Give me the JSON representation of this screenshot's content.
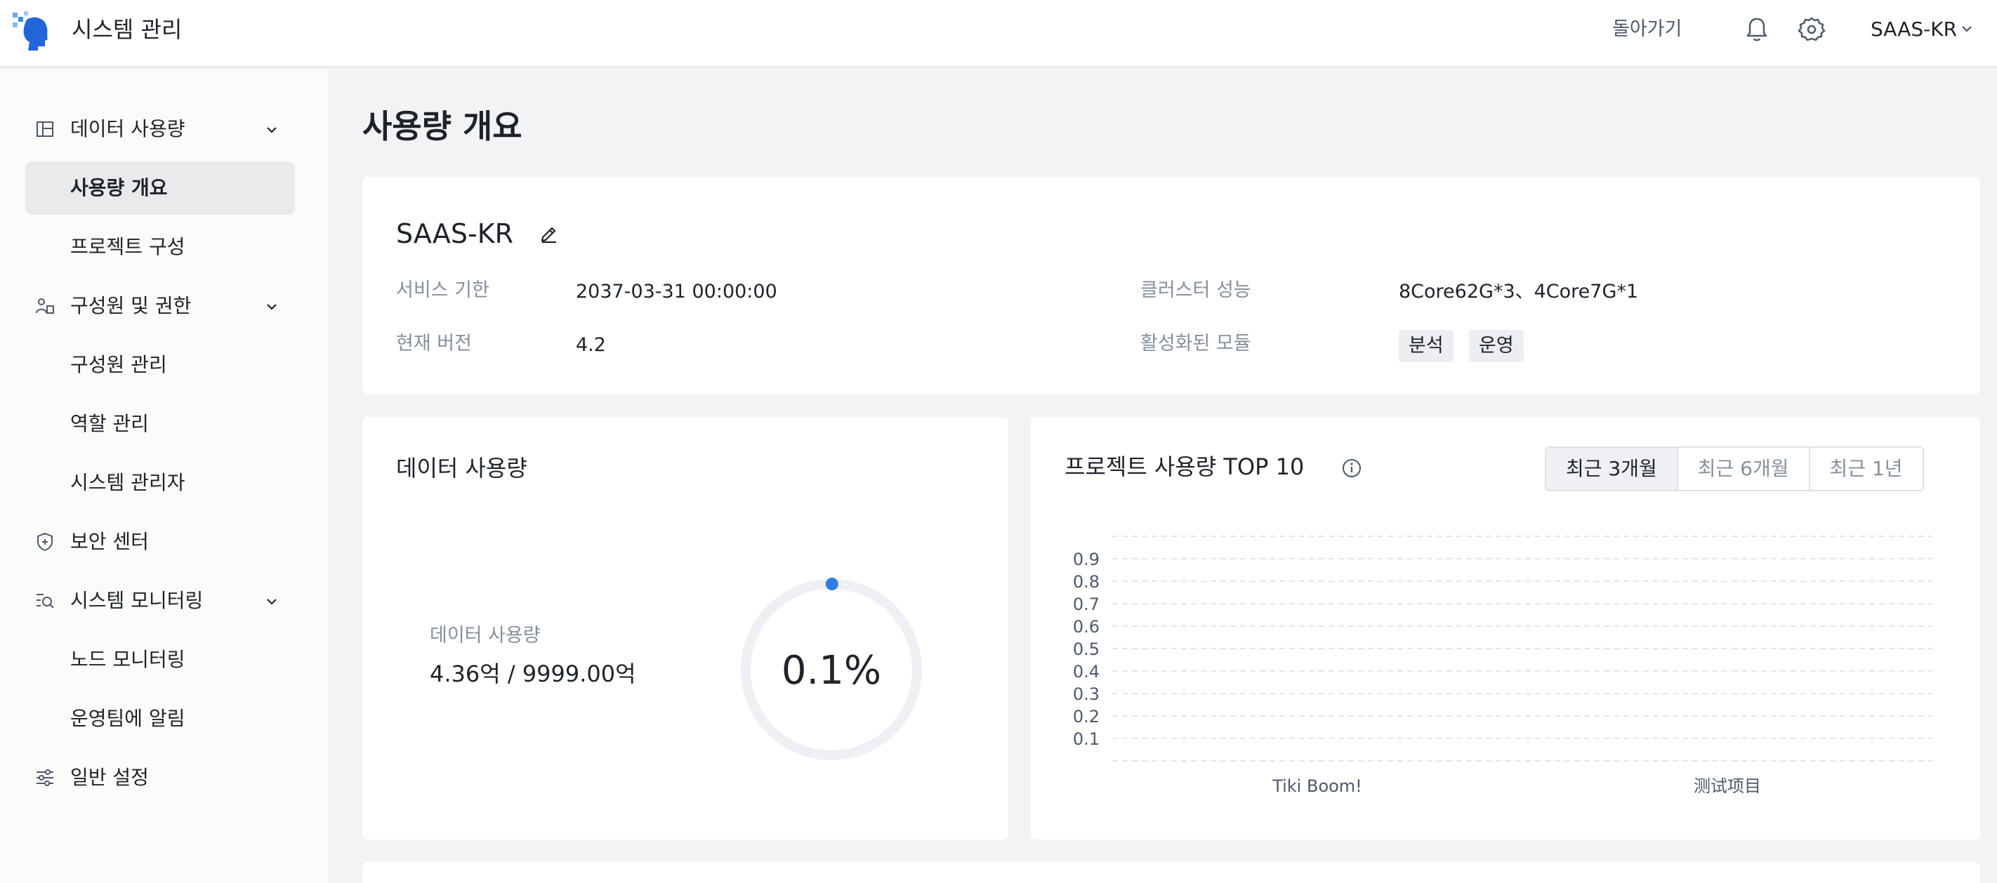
{
  "header": {
    "app_title": "시스템 관리",
    "back_label": "돌아가기",
    "tenant": "SAAS-KR"
  },
  "sidebar": {
    "items": [
      {
        "label": "데이터 사용량",
        "type": "group",
        "icon": "dashboard-icon"
      },
      {
        "label": "사용량 개요",
        "type": "sub",
        "active": true
      },
      {
        "label": "프로젝트 구성",
        "type": "sub"
      },
      {
        "label": "구성원 및 권한",
        "type": "group",
        "icon": "users-icon"
      },
      {
        "label": "구성원 관리",
        "type": "sub"
      },
      {
        "label": "역할 관리",
        "type": "sub"
      },
      {
        "label": "시스템 관리자",
        "type": "sub"
      },
      {
        "label": "보안 센터",
        "type": "item",
        "icon": "shield-icon"
      },
      {
        "label": "시스템 모니터링",
        "type": "group",
        "icon": "monitor-search-icon"
      },
      {
        "label": "노드 모니터링",
        "type": "sub"
      },
      {
        "label": "운영팀에 알림",
        "type": "sub"
      },
      {
        "label": "일반 설정",
        "type": "item",
        "icon": "sliders-icon"
      }
    ]
  },
  "page": {
    "title": "사용량 개요"
  },
  "info": {
    "tenant_name": "SAAS-KR",
    "service_period_label": "서비스 기한",
    "service_period_value": "2037-03-31 00:00:00",
    "version_label": "현재 버전",
    "version_value": "4.2",
    "cluster_label": "클러스터 성능",
    "cluster_value": "8Core62G*3、4Core7G*1",
    "modules_label": "활성화된 모듈",
    "modules": [
      "분석",
      "운영"
    ]
  },
  "usage": {
    "title": "데이터 사용량",
    "label": "데이터 사용량",
    "value": "4.36억 / 9999.00억",
    "percent_text": "0.1%",
    "percent": 0.1
  },
  "top_projects": {
    "title": "프로젝트 사용량 TOP 10",
    "ranges": [
      "최근 3개월",
      "최근 6개월",
      "최근 1년"
    ],
    "active_range": "최근 3개월"
  },
  "chart_data": {
    "type": "bar",
    "categories": [
      "Tiki Boom!",
      "测试项目"
    ],
    "values": [
      0,
      0
    ],
    "yticks": [
      "0.1",
      "0.2",
      "0.3",
      "0.4",
      "0.5",
      "0.6",
      "0.7",
      "0.8",
      "0.9"
    ],
    "ylim": [
      0,
      1
    ],
    "grid": true,
    "title": "",
    "xlabel": "",
    "ylabel": ""
  },
  "colors": {
    "accent": "#2f7be6",
    "gauge_track": "#eef0f3",
    "grid": "#e4e6ea"
  }
}
